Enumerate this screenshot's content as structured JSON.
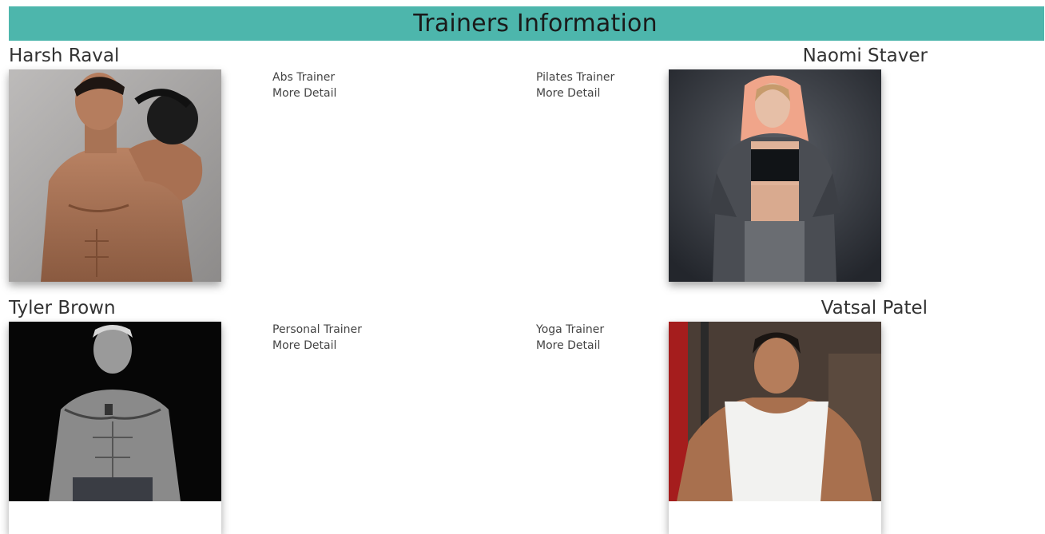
{
  "header": {
    "title": "Trainers Information"
  },
  "trainers": [
    {
      "name": "Harsh Raval",
      "role": "Abs Trainer",
      "link": "More Detail"
    },
    {
      "name": "Naomi Staver",
      "role": "Pilates Trainer",
      "link": "More Detail"
    },
    {
      "name": "Tyler Brown",
      "role": "Personal Trainer",
      "link": "More Detail"
    },
    {
      "name": "Vatsal Patel",
      "role": "Yoga Trainer",
      "link": "More Detail"
    }
  ],
  "colors": {
    "header_bg": "#4db6ac",
    "text": "#333333"
  }
}
